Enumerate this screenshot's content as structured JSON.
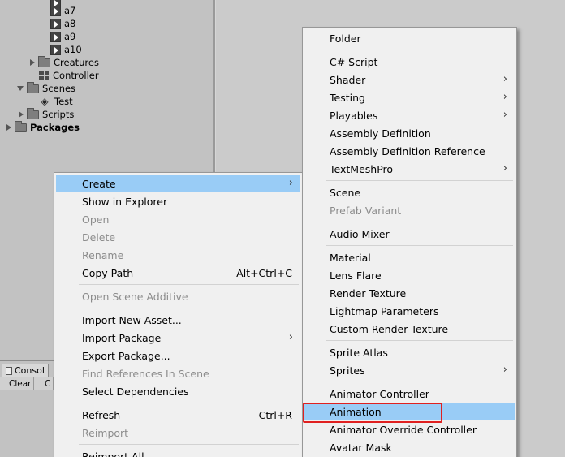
{
  "project_tree": {
    "items": [
      {
        "label": "a7"
      },
      {
        "label": "a8"
      },
      {
        "label": "a9"
      },
      {
        "label": "a10"
      },
      {
        "label": "Creatures"
      },
      {
        "label": "Controller"
      },
      {
        "label": "Scenes"
      },
      {
        "label": "Test"
      },
      {
        "label": "Scripts"
      },
      {
        "label": "Packages"
      }
    ]
  },
  "console": {
    "tab_label": "Consol",
    "clear_label": "Clear",
    "collapse_label": "C"
  },
  "context_menu": {
    "items": [
      {
        "label": "Create"
      },
      {
        "label": "Show in Explorer"
      },
      {
        "label": "Open"
      },
      {
        "label": "Delete"
      },
      {
        "label": "Rename"
      },
      {
        "label": "Copy Path",
        "shortcut": "Alt+Ctrl+C"
      },
      {
        "label": "Open Scene Additive"
      },
      {
        "label": "Import New Asset..."
      },
      {
        "label": "Import Package"
      },
      {
        "label": "Export Package..."
      },
      {
        "label": "Find References In Scene"
      },
      {
        "label": "Select Dependencies"
      },
      {
        "label": "Refresh",
        "shortcut": "Ctrl+R"
      },
      {
        "label": "Reimport"
      },
      {
        "label": "Reimport All"
      }
    ]
  },
  "create_submenu": {
    "items": [
      {
        "label": "Folder"
      },
      {
        "label": "C# Script"
      },
      {
        "label": "Shader"
      },
      {
        "label": "Testing"
      },
      {
        "label": "Playables"
      },
      {
        "label": "Assembly Definition"
      },
      {
        "label": "Assembly Definition Reference"
      },
      {
        "label": "TextMeshPro"
      },
      {
        "label": "Scene"
      },
      {
        "label": "Prefab Variant"
      },
      {
        "label": "Audio Mixer"
      },
      {
        "label": "Material"
      },
      {
        "label": "Lens Flare"
      },
      {
        "label": "Render Texture"
      },
      {
        "label": "Lightmap Parameters"
      },
      {
        "label": "Custom Render Texture"
      },
      {
        "label": "Sprite Atlas"
      },
      {
        "label": "Sprites"
      },
      {
        "label": "Animator Controller"
      },
      {
        "label": "Animation"
      },
      {
        "label": "Animator Override Controller"
      },
      {
        "label": "Avatar Mask"
      }
    ]
  },
  "colors": {
    "menu_highlight": "#99ccf6",
    "annotation_box": "#e02020"
  }
}
